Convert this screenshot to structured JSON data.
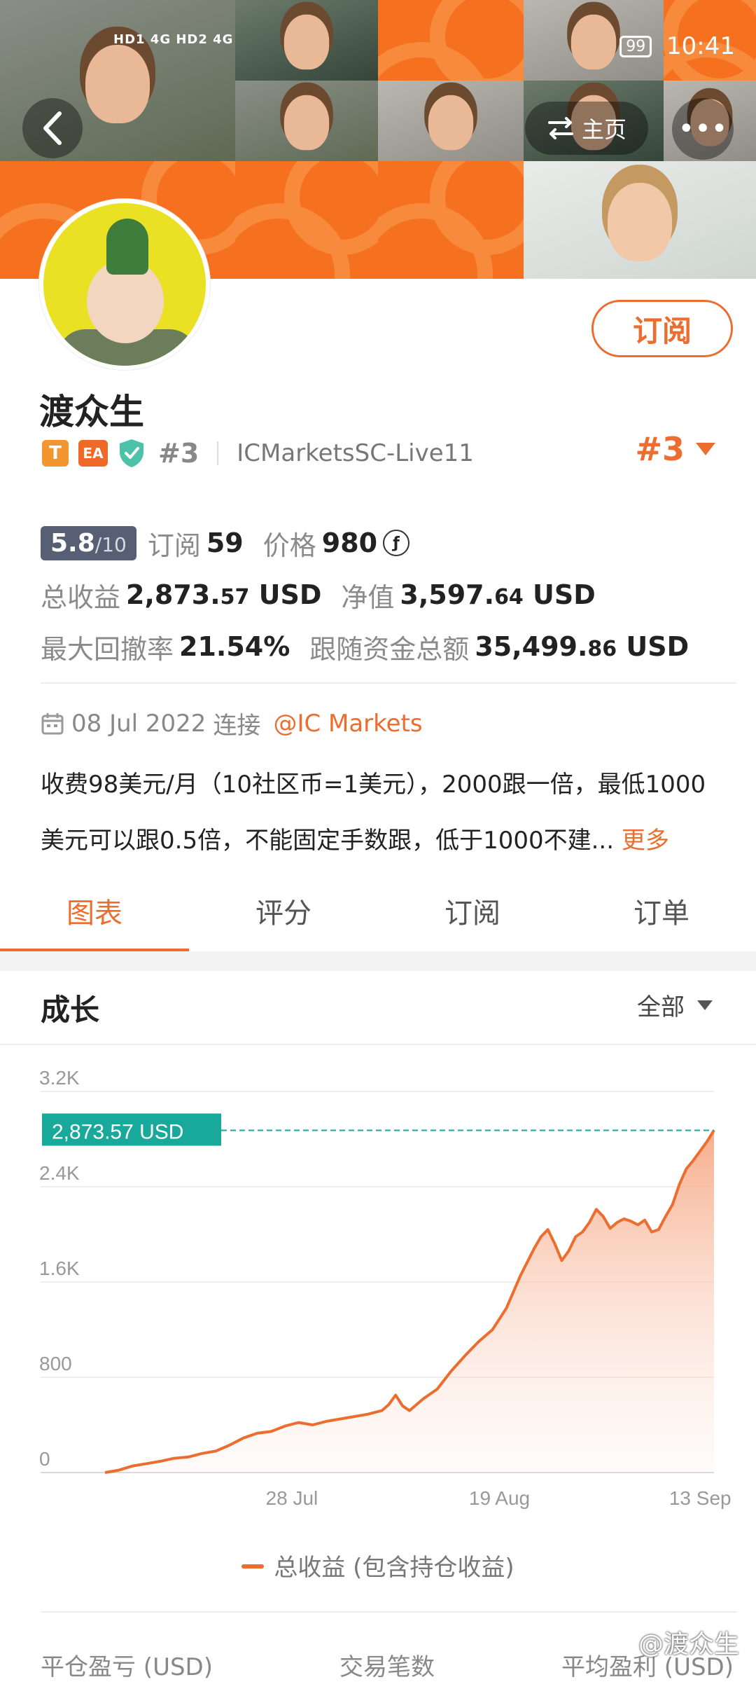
{
  "status_bar": {
    "network": "HD1 4G  HD2 4G",
    "battery": "99",
    "time": "10:41"
  },
  "nav": {
    "home_label": "主页",
    "more_label": "•••"
  },
  "profile": {
    "subscribe_label": "订阅",
    "name": "渡众生",
    "badge_t": "T",
    "badge_ea": "EA",
    "rank_small": "#3",
    "server": "ICMarketsSC-Live11",
    "rank_big": "#3"
  },
  "stats": {
    "score": "5.8",
    "score_max": "/10",
    "subscribe_label": "订阅",
    "subscribe_count": "59",
    "price_label": "价格",
    "price_value": "980",
    "price_unit": "ƒ",
    "total_profit_label": "总收益",
    "total_profit_int": "2,873.",
    "total_profit_dec": "57",
    "total_profit_unit": " USD",
    "equity_label": "净值",
    "equity_int": "3,597.",
    "equity_dec": "64",
    "equity_unit": " USD",
    "drawdown_label": "最大回撤率",
    "drawdown_value": "21.54%",
    "follow_funds_label": "跟随资金总额",
    "follow_funds_int": "35,499.",
    "follow_funds_dec": "86",
    "follow_funds_unit": " USD"
  },
  "connection": {
    "date": "08 Jul 2022",
    "connect_label": "连接",
    "broker": "@IC Markets"
  },
  "description": {
    "line1": "收费98美元/月（10社区币=1美元），2000跟一倍，最低1000",
    "line2": "美元可以跟0.5倍，不能固定手数跟，低于1000不建...",
    "more": "更多"
  },
  "tabs": [
    {
      "label": "图表"
    },
    {
      "label": "评分"
    },
    {
      "label": "订阅"
    },
    {
      "label": "订单"
    }
  ],
  "growth": {
    "title": "成长",
    "range": "全部"
  },
  "chart_data": {
    "type": "area",
    "title": "",
    "series": [
      {
        "name": "总收益 (包含持仓收益)",
        "color": "#ec6d2d"
      }
    ],
    "yticks": [
      "0",
      "800",
      "1.6K",
      "2.4K",
      "3.2K"
    ],
    "ylim": [
      0,
      3200
    ],
    "xticks": [
      "28 Jul",
      "19 Aug",
      "13 Sep"
    ],
    "current_label": "2,873.57 USD",
    "current_value": 2873.57,
    "points": [
      [
        0,
        0
      ],
      [
        2,
        20
      ],
      [
        4,
        55
      ],
      [
        6,
        75
      ],
      [
        8,
        95
      ],
      [
        10,
        120
      ],
      [
        12,
        130
      ],
      [
        14,
        160
      ],
      [
        16,
        180
      ],
      [
        18,
        230
      ],
      [
        20,
        290
      ],
      [
        22,
        330
      ],
      [
        24,
        345
      ],
      [
        26,
        390
      ],
      [
        28,
        420
      ],
      [
        30,
        400
      ],
      [
        32,
        430
      ],
      [
        34,
        450
      ],
      [
        36,
        470
      ],
      [
        38,
        490
      ],
      [
        40,
        520
      ],
      [
        41,
        570
      ],
      [
        42,
        650
      ],
      [
        43,
        560
      ],
      [
        44,
        520
      ],
      [
        46,
        620
      ],
      [
        48,
        700
      ],
      [
        50,
        850
      ],
      [
        52,
        980
      ],
      [
        54,
        1100
      ],
      [
        56,
        1200
      ],
      [
        58,
        1380
      ],
      [
        60,
        1650
      ],
      [
        62,
        1880
      ],
      [
        63,
        1980
      ],
      [
        64,
        2040
      ],
      [
        65,
        1920
      ],
      [
        66,
        1780
      ],
      [
        67,
        1860
      ],
      [
        68,
        1980
      ],
      [
        69,
        2020
      ],
      [
        70,
        2100
      ],
      [
        71,
        2210
      ],
      [
        72,
        2150
      ],
      [
        73,
        2050
      ],
      [
        74,
        2100
      ],
      [
        75,
        2130
      ],
      [
        76,
        2110
      ],
      [
        77,
        2080
      ],
      [
        78,
        2120
      ],
      [
        79,
        2020
      ],
      [
        80,
        2040
      ],
      [
        81,
        2150
      ],
      [
        82,
        2250
      ],
      [
        83,
        2420
      ],
      [
        84,
        2550
      ],
      [
        85,
        2620
      ],
      [
        86,
        2700
      ],
      [
        87,
        2780
      ],
      [
        88,
        2873.57
      ]
    ],
    "xtick_positions": [
      27,
      57,
      86
    ]
  },
  "footer": {
    "col1": "平仓盈亏 (USD)",
    "col2": "交易笔数",
    "col3": "平均盈利 (USD)",
    "watermark": "@渡众生"
  }
}
